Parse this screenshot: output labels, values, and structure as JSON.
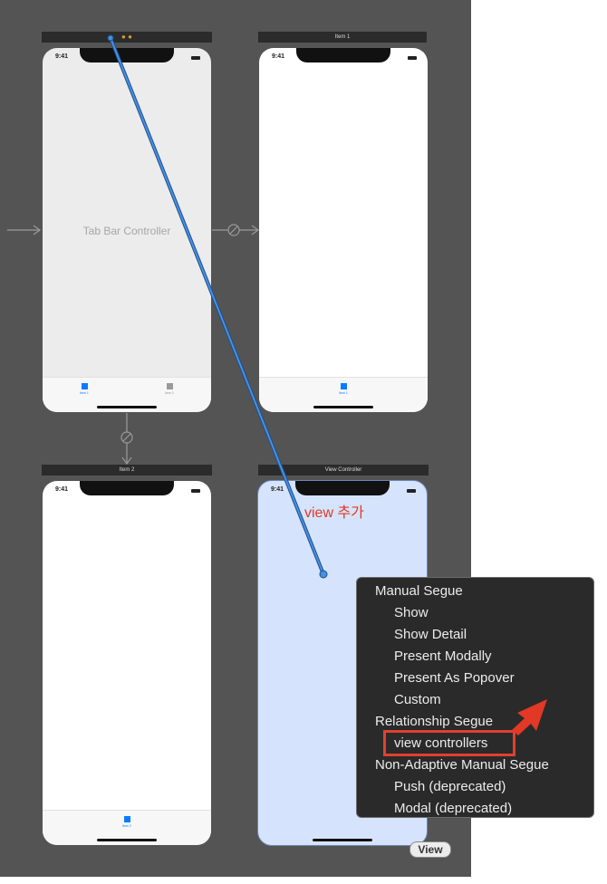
{
  "scenes": {
    "tab_bar_controller": {
      "time": "9:41",
      "label": "Tab Bar Controller",
      "tabs": [
        {
          "label": "Item 1"
        },
        {
          "label": "Item 2"
        }
      ]
    },
    "item1": {
      "title": "Item 1",
      "time": "9:41",
      "tab_label": "Item 1"
    },
    "item2": {
      "title": "Item 2",
      "time": "9:41",
      "tab_label": "Item 2"
    },
    "view_controller": {
      "title": "View Controller",
      "time": "9:41"
    }
  },
  "annotation": {
    "text": "view 추가"
  },
  "context_menu": {
    "items": [
      {
        "label": "Manual Segue",
        "kind": "header"
      },
      {
        "label": "Show",
        "kind": "item"
      },
      {
        "label": "Show Detail",
        "kind": "item"
      },
      {
        "label": "Present Modally",
        "kind": "item"
      },
      {
        "label": "Present As Popover",
        "kind": "item"
      },
      {
        "label": "Custom",
        "kind": "item"
      },
      {
        "label": "Relationship Segue",
        "kind": "header"
      },
      {
        "label": "view controllers",
        "kind": "item",
        "highlighted": true
      },
      {
        "label": "Non-Adaptive Manual Segue",
        "kind": "header"
      },
      {
        "label": "Push (deprecated)",
        "kind": "item"
      },
      {
        "label": "Modal (deprecated)",
        "kind": "item"
      }
    ]
  },
  "drag_tag": {
    "label": "View"
  },
  "colors": {
    "accent": "#0a7cff",
    "annotation_red": "#e23826",
    "canvas_bg": "#545454",
    "selection_fill": "#d5e4fc"
  }
}
